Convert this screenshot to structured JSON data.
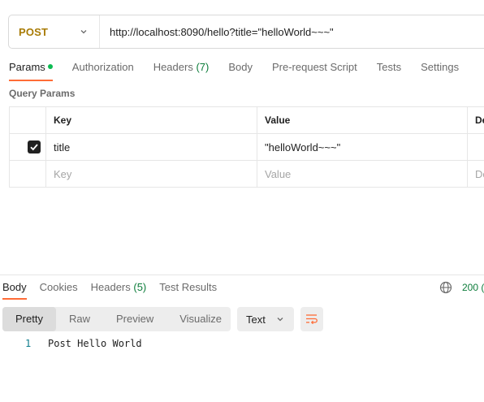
{
  "request": {
    "method": "POST",
    "url": "http://localhost:8090/hello?title=\"helloWorld~~~\""
  },
  "request_tabs": [
    {
      "label": "Params",
      "active": true
    },
    {
      "label": "Authorization"
    },
    {
      "label": "Headers",
      "count": "(7)"
    },
    {
      "label": "Body"
    },
    {
      "label": "Pre-request Script"
    },
    {
      "label": "Tests"
    },
    {
      "label": "Settings"
    }
  ],
  "query_params": {
    "title": "Query Params",
    "columns": [
      "Key",
      "Value",
      "De"
    ],
    "rows": [
      {
        "checked": true,
        "key": "title",
        "value": "\"helloWorld~~~\""
      }
    ],
    "placeholder": {
      "key": "Key",
      "value": "Value",
      "desc": "De"
    }
  },
  "response_tabs": [
    {
      "label": "Body",
      "active": true
    },
    {
      "label": "Cookies"
    },
    {
      "label": "Headers",
      "count": "(5)"
    },
    {
      "label": "Test Results"
    }
  ],
  "response_status": "200 (",
  "view_modes": [
    "Pretty",
    "Raw",
    "Preview",
    "Visualize"
  ],
  "active_view_mode": "Pretty",
  "format": "Text",
  "body_lines": [
    {
      "number": "1",
      "text": "Post Hello World"
    }
  ],
  "colors": {
    "accent": "#ff6c37",
    "method_post": "#a87b05",
    "success": "#0c7c3a",
    "params_dot": "#0cbb52"
  },
  "icons": {
    "method_dropdown": "chevron-down-icon",
    "checkbox": "checkmark-icon",
    "network": "globe-icon",
    "format_dropdown": "chevron-down-icon",
    "wrap": "wrap-lines-icon"
  }
}
